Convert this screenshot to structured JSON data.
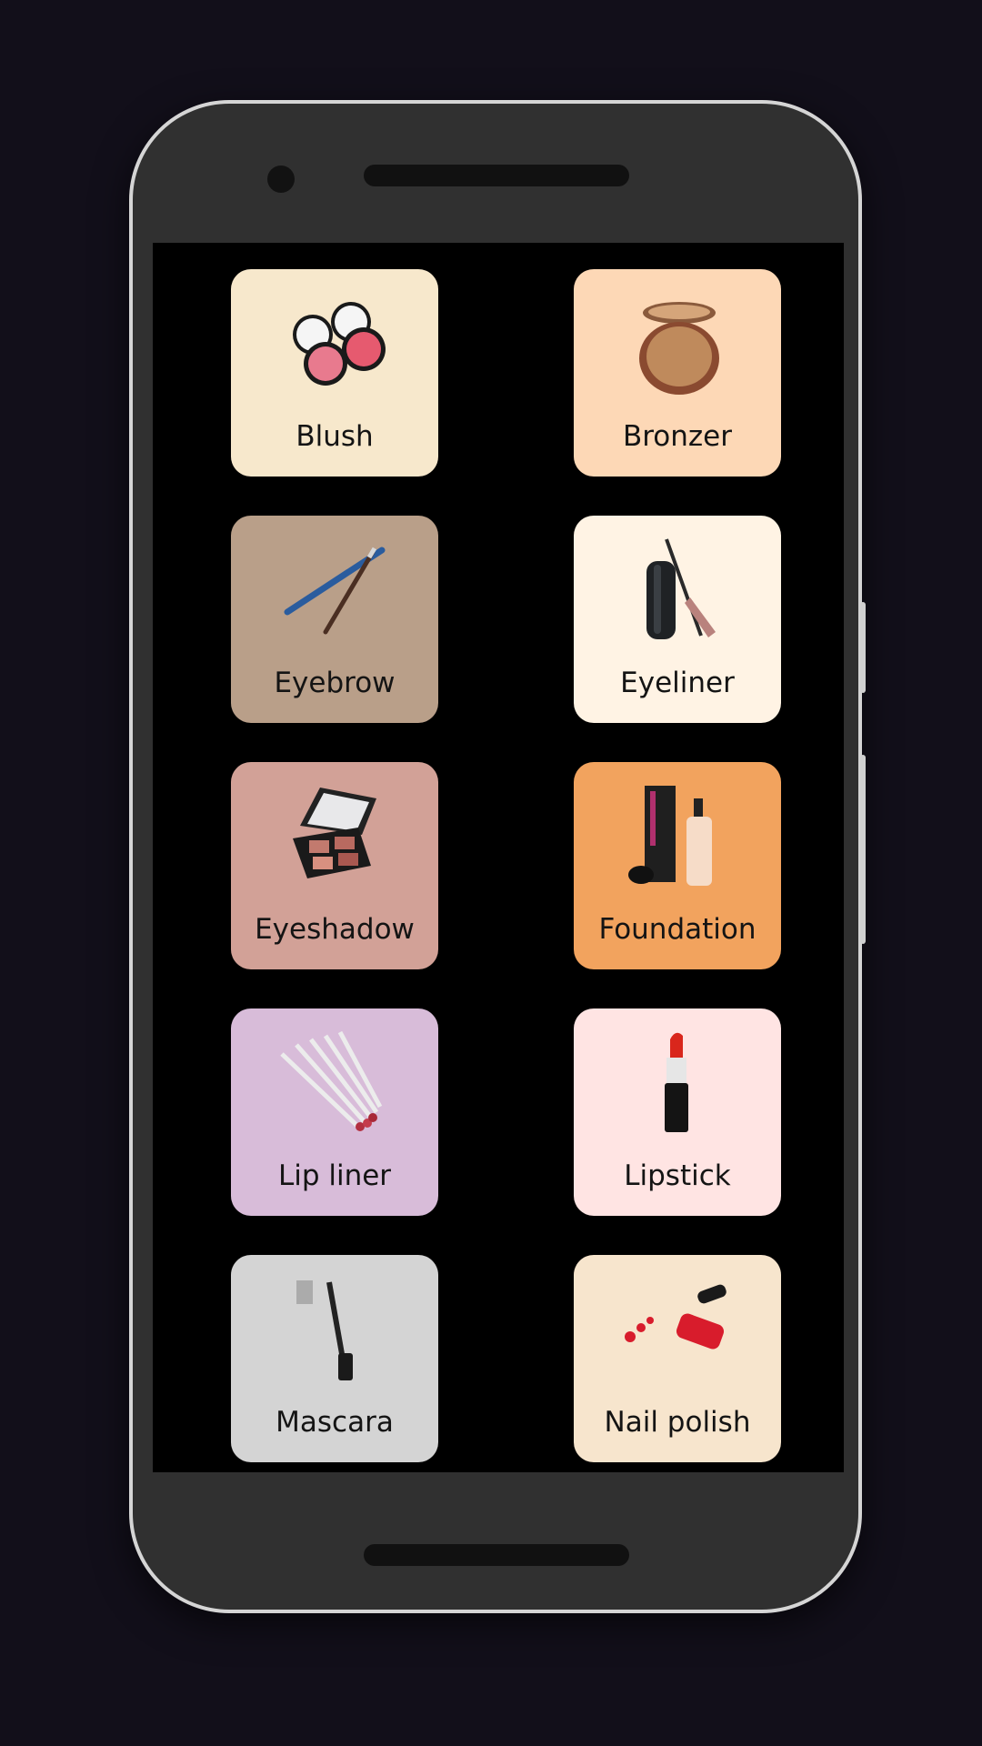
{
  "screen": {
    "background": "#000000"
  },
  "categories": [
    {
      "label": "Blush",
      "icon": "blush-compact-icon",
      "color": "#f7e8cc"
    },
    {
      "label": "Bronzer",
      "icon": "bronzer-compact-icon",
      "color": "#fdd8b6"
    },
    {
      "label": "Eyebrow",
      "icon": "eyebrow-pencil-icon",
      "color": "#b99f89"
    },
    {
      "label": "Eyeliner",
      "icon": "eyeliner-icon",
      "color": "#fff3e4"
    },
    {
      "label": "Eyeshadow",
      "icon": "eyeshadow-palette-icon",
      "color": "#d2a197"
    },
    {
      "label": "Foundation",
      "icon": "foundation-bottle-icon",
      "color": "#f2a35e"
    },
    {
      "label": "Lip liner",
      "icon": "lip-liner-pencils-icon",
      "color": "#d8bcd9"
    },
    {
      "label": "Lipstick",
      "icon": "lipstick-icon",
      "color": "#ffe4e3"
    },
    {
      "label": "Mascara",
      "icon": "mascara-wand-icon",
      "color": "#d4d4d4"
    },
    {
      "label": "Nail polish",
      "icon": "nail-polish-bottle-icon",
      "color": "#f7e5cd"
    }
  ]
}
